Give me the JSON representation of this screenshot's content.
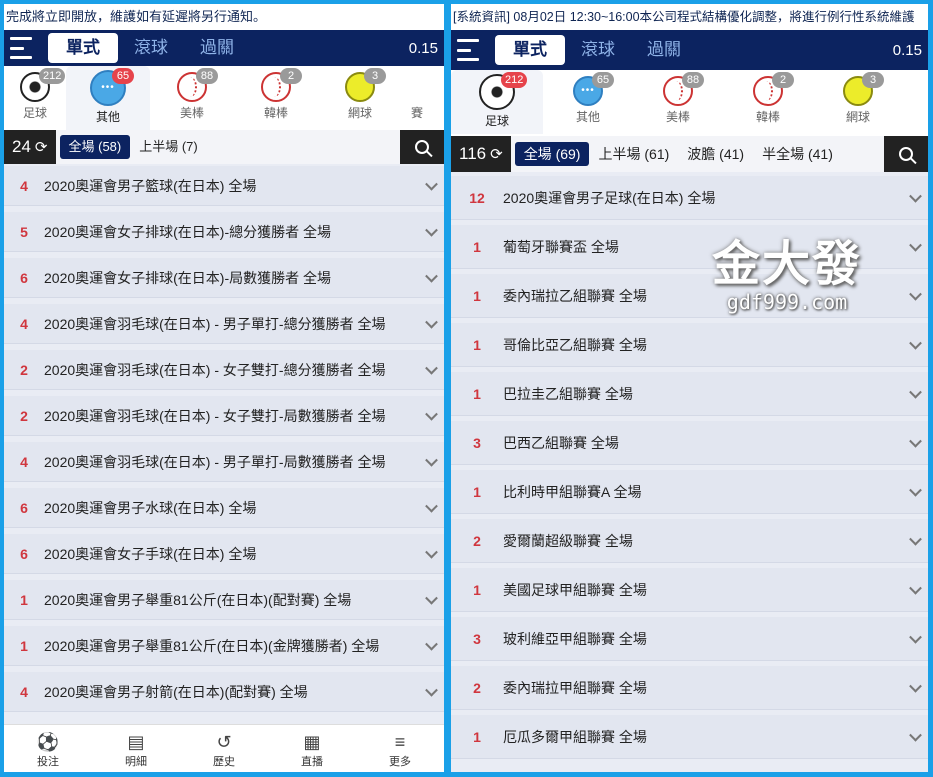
{
  "left": {
    "ticker": "完成將立即開放，維護如有延遲將另行通知。",
    "tabs": [
      "單式",
      "滾球",
      "過關"
    ],
    "odds": "0.15",
    "sports": [
      {
        "label": "足球",
        "count": "212",
        "icon": "soccer-ball-icon"
      },
      {
        "label": "其他",
        "count": "65",
        "icon": "other-sports-icon"
      },
      {
        "label": "美棒",
        "count": "88",
        "icon": "baseball-icon"
      },
      {
        "label": "韓棒",
        "count": "2",
        "icon": "baseball-icon"
      },
      {
        "label": "網球",
        "count": "3",
        "icon": "tennis-ball-icon"
      },
      {
        "label": "賽",
        "count": "",
        "icon": "more-icon"
      }
    ],
    "total": "24",
    "filters": [
      "全場 (58)",
      "上半場 (7)"
    ],
    "rows": [
      {
        "num": "4",
        "name": "2020奧運會男子籃球(在日本) 全場"
      },
      {
        "num": "5",
        "name": "2020奧運會女子排球(在日本)-總分獲勝者 全場"
      },
      {
        "num": "6",
        "name": "2020奧運會女子排球(在日本)-局數獲勝者 全場"
      },
      {
        "num": "4",
        "name": "2020奧運會羽毛球(在日本) - 男子單打-總分獲勝者 全場"
      },
      {
        "num": "2",
        "name": "2020奧運會羽毛球(在日本) - 女子雙打-總分獲勝者 全場"
      },
      {
        "num": "2",
        "name": "2020奧運會羽毛球(在日本) - 女子雙打-局數獲勝者 全場"
      },
      {
        "num": "4",
        "name": "2020奧運會羽毛球(在日本) - 男子單打-局數獲勝者 全場"
      },
      {
        "num": "6",
        "name": "2020奧運會男子水球(在日本) 全場"
      },
      {
        "num": "6",
        "name": "2020奧運會女子手球(在日本) 全場"
      },
      {
        "num": "1",
        "name": "2020奧運會男子舉重81公斤(在日本)(配對賽) 全場"
      },
      {
        "num": "1",
        "name": "2020奧運會男子舉重81公斤(在日本)(金牌獲勝者) 全場"
      },
      {
        "num": "4",
        "name": "2020奧運會男子射箭(在日本)(配對賽) 全場"
      }
    ],
    "nav": [
      {
        "label": "投注",
        "icon": "soccer-ball-icon"
      },
      {
        "label": "明細",
        "icon": "document-icon"
      },
      {
        "label": "歷史",
        "icon": "history-icon"
      },
      {
        "label": "直播",
        "icon": "film-icon"
      },
      {
        "label": "更多",
        "icon": "menu-icon"
      }
    ]
  },
  "right": {
    "ticker": "[系統資訊] 08月02日 12:30~16:00本公司程式結構優化調整，將進行例行性系統維護",
    "tabs": [
      "單式",
      "滾球",
      "過關"
    ],
    "odds": "0.15",
    "sports": [
      {
        "label": "足球",
        "count": "212",
        "icon": "soccer-ball-icon"
      },
      {
        "label": "其他",
        "count": "65",
        "icon": "other-sports-icon"
      },
      {
        "label": "美棒",
        "count": "88",
        "icon": "baseball-icon"
      },
      {
        "label": "韓棒",
        "count": "2",
        "icon": "baseball-icon"
      },
      {
        "label": "網球",
        "count": "3",
        "icon": "tennis-ball-icon"
      }
    ],
    "total": "116",
    "filters": [
      "全場 (69)",
      "上半場 (61)",
      "波膽 (41)",
      "半全場 (41)"
    ],
    "rows": [
      {
        "num": "12",
        "name": "2020奧運會男子足球(在日本) 全場"
      },
      {
        "num": "1",
        "name": "葡萄牙聯賽盃 全場"
      },
      {
        "num": "1",
        "name": "委內瑞拉乙組聯賽 全場"
      },
      {
        "num": "1",
        "name": "哥倫比亞乙組聯賽 全場"
      },
      {
        "num": "1",
        "name": "巴拉圭乙組聯賽 全場"
      },
      {
        "num": "3",
        "name": "巴西乙組聯賽 全場"
      },
      {
        "num": "1",
        "name": "比利時甲組聯賽A 全場"
      },
      {
        "num": "2",
        "name": "愛爾蘭超級聯賽 全場"
      },
      {
        "num": "1",
        "name": "美國足球甲組聯賽 全場"
      },
      {
        "num": "3",
        "name": "玻利維亞甲組聯賽 全場"
      },
      {
        "num": "2",
        "name": "委內瑞拉甲組聯賽 全場"
      },
      {
        "num": "1",
        "name": "厄瓜多爾甲組聯賽 全場"
      }
    ]
  },
  "watermark": {
    "brand": "金大發",
    "domain": "gdf999.com"
  }
}
